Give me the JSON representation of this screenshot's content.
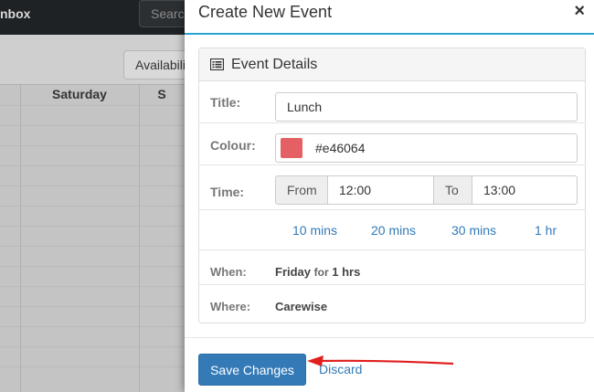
{
  "background": {
    "brand_text": "nbox",
    "search_text": "Search",
    "availability_label": "Availability",
    "columns": [
      "Saturday",
      "S"
    ]
  },
  "modal": {
    "title": "Create New Event",
    "close_glyph": "×",
    "panel_heading": "Event Details",
    "fields": {
      "title_label": "Title:",
      "title_value": "Lunch",
      "colour_label": "Colour:",
      "colour_value": "#e46064",
      "colour_swatch": "#e46064",
      "time_label": "Time:",
      "from_label": "From",
      "from_value": "12:00",
      "to_label": "To",
      "to_value": "13:00"
    },
    "durations": [
      "10 mins",
      "20 mins",
      "30 mins",
      "1 hr"
    ],
    "when_label": "When:",
    "when_day": "Friday",
    "when_for": "for",
    "when_duration": "1 hrs",
    "where_label": "Where:",
    "where_value": "Carewise",
    "save_label": "Save Changes",
    "discard_label": "Discard"
  },
  "colors": {
    "accent": "#337ab7",
    "header_rule": "#2aa3cf",
    "arrow": "#e0201e"
  }
}
